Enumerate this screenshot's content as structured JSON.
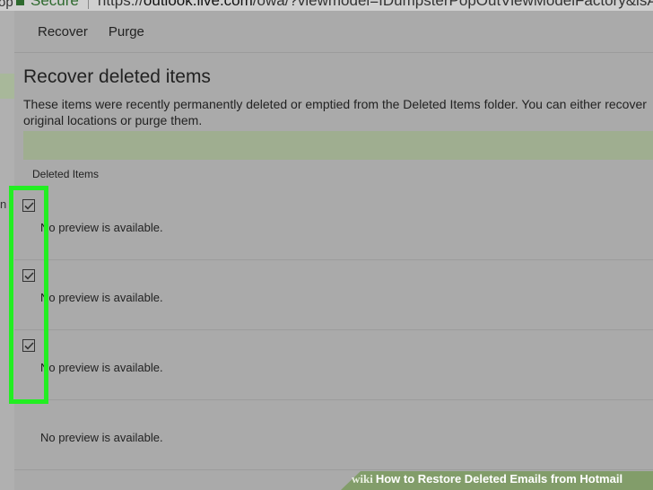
{
  "browser": {
    "secure_label": "Secure",
    "url_prefix": "https://",
    "url_host": "outlook.live.com",
    "url_path": "/owa/?viewmodel=IDumpsterPopOutViewModelFactory&isArch",
    "left_tab_fragment": "op"
  },
  "background": {
    "letter": "n"
  },
  "toolbar": {
    "recover_label": "Recover",
    "purge_label": "Purge"
  },
  "dialog": {
    "title": "Recover deleted items",
    "description": "These items were recently permanently deleted or emptied from the Deleted Items folder. You can either recover original locations or purge them.",
    "column_header": "Deleted Items"
  },
  "items": [
    {
      "checked": true,
      "preview": "No preview is available."
    },
    {
      "checked": true,
      "preview": "No preview is available."
    },
    {
      "checked": true,
      "preview": "No preview is available."
    },
    {
      "checked": false,
      "preview": "No preview is available."
    }
  ],
  "colors": {
    "highlight": "#22ee22",
    "green_bar": "#9fae90",
    "banner": "#809c66"
  },
  "banner": {
    "wiki": "wiki",
    "title": "How to Restore Deleted Emails from Hotmail"
  }
}
